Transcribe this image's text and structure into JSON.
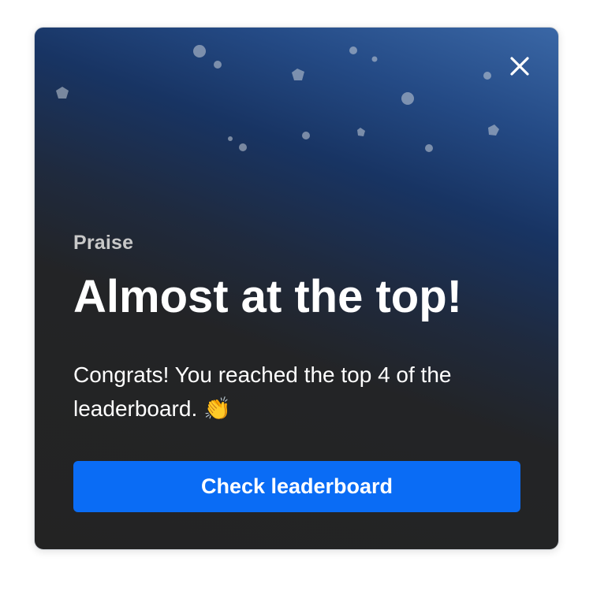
{
  "dialog": {
    "eyebrow": "Praise",
    "title": "Almost at the top!",
    "message": "Congrats! You reached the top 4 of the leaderboard.",
    "emoji": "👏",
    "cta_label": "Check leaderboard",
    "close_icon": "close-icon",
    "decoration": "confetti"
  },
  "colors": {
    "gradient_top": "#3a67a6",
    "gradient_bottom": "#232323",
    "primary_button": "#0a6cf5",
    "eyebrow_text": "#c8c8c8"
  }
}
